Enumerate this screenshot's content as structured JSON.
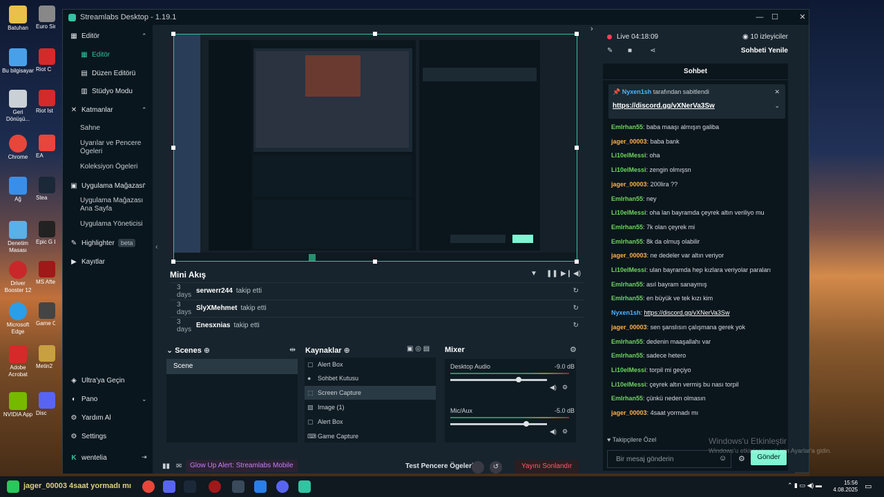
{
  "window": {
    "title": "Streamlabs Desktop - 1.19.1"
  },
  "desktop": {
    "left_icons": [
      "Batuhan",
      "Bu bilgisayar",
      "Geri Dönüşü...",
      "Chrome",
      "Ağ",
      "Denetim Masası",
      "Driver Booster 12",
      "Microsoft Edge",
      "Adobe Acrobat",
      "NVIDIA App"
    ],
    "right_icons": [
      "Euro Simul",
      "Riot C",
      "Riot Ist",
      "EA",
      "Stea",
      "Epic G Laun",
      "MS Afterb",
      "Game Clie",
      "Metin2",
      "Disc"
    ]
  },
  "sidebar": {
    "editor": "Editör",
    "editor_active": "Editör",
    "layout_editor": "Düzen Editörü",
    "studio_mode": "Stüdyo Modu",
    "layers": "Katmanlar",
    "scene": "Sahne",
    "alerts_widgets": "Uyarılar ve Pencere Ögeleri",
    "collection": "Koleksiyon Ögeleri",
    "app_store": "Uygulama Mağazası",
    "app_store_home": "Uygulama Mağazası Ana Sayfa",
    "app_manager": "Uygulama Yöneticisi",
    "highlighter": "Highlighter",
    "beta": "beta",
    "recordings": "Kayıtlar",
    "ultra": "Ultra'ya Geçin",
    "dashboard": "Pano",
    "help": "Yardım Al",
    "settings": "Settings",
    "user": "wentelia"
  },
  "minifeed": {
    "title": "Mini Akış",
    "rows": [
      {
        "time": "3 days",
        "user": "serwerr244",
        "action": "takip etti"
      },
      {
        "time": "3 days",
        "user": "SlyXMehmet",
        "action": "takip etti"
      },
      {
        "time": "3 days",
        "user": "Enesxnias",
        "action": "takip etti"
      }
    ]
  },
  "scenes": {
    "title": "Scenes",
    "items": [
      "Scene"
    ]
  },
  "sources": {
    "title": "Kaynaklar",
    "items": [
      "Alert Box",
      "Sohbet Kutusu",
      "Screen Capture",
      "Image (1)",
      "Alert Box",
      "Game Capture"
    ]
  },
  "mixer": {
    "title": "Mixer",
    "channels": [
      {
        "name": "Desktop Audio",
        "db": "-9.0 dB",
        "level": 0.72
      },
      {
        "name": "Mic/Aux",
        "db": "-5.0 dB",
        "level": 0.8
      }
    ]
  },
  "footer": {
    "glowup": "Glow Up Alert: Streamlabs Mobile",
    "test": "Test Pencere Ögeleri",
    "end": "Yayını Sonlandır"
  },
  "chat": {
    "live": "Live",
    "timer": "04:18:09",
    "viewers": "10 izleyiciler",
    "refresh": "Sohbeti Yenile",
    "header": "Sohbet",
    "pinned_by": "Nyxen1sh",
    "pinned_suffix": "tarafından sabitlendi",
    "pinned_link": "https://discord.gg/vXNerVa3Sw",
    "messages": [
      {
        "user": "Emlrhan55",
        "color": "#6fd35f",
        "text": "baba maaşı almışın galiba"
      },
      {
        "user": "jager_00003",
        "color": "#ffb347",
        "text": "baba bank"
      },
      {
        "user": "Li10elMessi",
        "color": "#6fd35f",
        "text": "oha"
      },
      {
        "user": "Li10elMessi",
        "color": "#6fd35f",
        "text": "zengin olmışsn"
      },
      {
        "user": "jager_00003",
        "color": "#ffb347",
        "text": "200lira ??"
      },
      {
        "user": "Emlrhan55",
        "color": "#6fd35f",
        "text": "ney"
      },
      {
        "user": "Li10elMessi",
        "color": "#6fd35f",
        "text": "oha lan bayramda çeyrek altın veriliyo mu"
      },
      {
        "user": "Emlrhan55",
        "color": "#6fd35f",
        "text": "7k olan çeyrek mi"
      },
      {
        "user": "Emlrhan55",
        "color": "#6fd35f",
        "text": "8k da olmuş olabilir"
      },
      {
        "user": "jager_00003",
        "color": "#ffb347",
        "text": "ne dedeler var altın veriyor"
      },
      {
        "user": "Li10elMessi",
        "color": "#6fd35f",
        "text": "ulan bayramda hep kızlara veriyolar paraları"
      },
      {
        "user": "Emlrhan55",
        "color": "#6fd35f",
        "text": "asıl bayram sanaymış"
      },
      {
        "user": "Emlrhan55",
        "color": "#6fd35f",
        "text": "en büyük ve tek kızı kim"
      },
      {
        "user": "Nyxen1sh",
        "color": "#4fb3ff",
        "text": "https://discord.gg/vXNerVa3Sw"
      },
      {
        "user": "jager_00003",
        "color": "#ffb347",
        "text": "sen şanslısın çalışmana gerek yok"
      },
      {
        "user": "Emlrhan55",
        "color": "#6fd35f",
        "text": "dedenin maaşallahı var"
      },
      {
        "user": "Emlrhan55",
        "color": "#6fd35f",
        "text": "sadece hetero"
      },
      {
        "user": "Li10elMessi",
        "color": "#6fd35f",
        "text": "torpil mi geçiyo"
      },
      {
        "user": "Li10elMessi",
        "color": "#6fd35f",
        "text": "çeyrek altın vermiş bu nası torpil"
      },
      {
        "user": "Emlrhan55",
        "color": "#6fd35f",
        "text": "çünkü neden olmasın"
      },
      {
        "user": "jager_00003",
        "color": "#ffb347",
        "text": "4saat yormadı mı"
      }
    ],
    "followers_only": "Takipçilere Özel",
    "input_placeholder": "Bir mesaj gönderin",
    "send": "Gönder"
  },
  "watermark": {
    "line1": "Windows'u Etkinleştir",
    "line2": "Windows'u etkinleştirmek için Ayarlar'a gidin."
  },
  "taskbar": {
    "overlay_text": "jager_00003 4saat yormadı mı",
    "time": "15:56",
    "date": "4.08.2025"
  }
}
